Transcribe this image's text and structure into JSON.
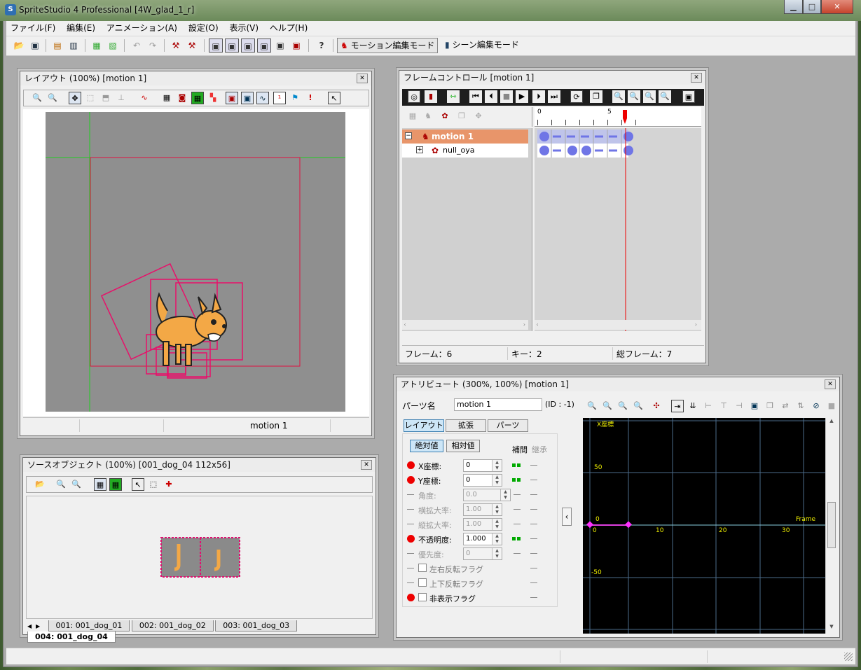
{
  "window": {
    "title": "SpriteStudio 4 Professional [4W_glad_1_r]",
    "app_icon": "spritestudio-icon"
  },
  "menu": [
    "ファイル(F)",
    "編集(E)",
    "アニメーション(A)",
    "設定(O)",
    "表示(V)",
    "ヘルプ(H)"
  ],
  "toolbar": {
    "motion_mode": "モーション編集モード",
    "scene_mode": "シーン編集モード"
  },
  "layout_panel": {
    "title": "レイアウト (100%) [motion 1]",
    "status": "motion 1"
  },
  "frame_panel": {
    "title": "フレームコントロール [motion 1]",
    "tree": [
      {
        "label": "motion 1",
        "selected": true
      },
      {
        "label": "null_oya",
        "selected": false
      }
    ],
    "ruler": {
      "zero": "0",
      "five": "5"
    },
    "status": {
      "frame": "フレーム：6",
      "key": "キー：2",
      "total": "総フレーム：7"
    }
  },
  "source_panel": {
    "title": "ソースオブジェクト (100%) [001_dog_04  112x56]",
    "tabs": [
      "001: 001_dog_01",
      "002: 001_dog_02",
      "003: 001_dog_03",
      "004: 001_dog_04"
    ],
    "active_tab": 3
  },
  "attr_panel": {
    "title": "アトリビュート (300%, 100%) [motion 1]",
    "part_name_label": "パーツ名",
    "part_name_value": "motion 1",
    "id_label": "(ID : -1)",
    "tabs": [
      "レイアウト",
      "拡張",
      "パーツ"
    ],
    "subtabs": [
      "絶対値",
      "相対値"
    ],
    "col_interp": "補間",
    "col_inherit": "継承",
    "rows": [
      {
        "label": "X座標:",
        "value": "0",
        "active": true
      },
      {
        "label": "Y座標:",
        "value": "0",
        "active": true
      },
      {
        "label": "角度:",
        "value": "0.0",
        "active": false
      },
      {
        "label": "横拡大率:",
        "value": "1.00",
        "active": false
      },
      {
        "label": "縦拡大率:",
        "value": "1.00",
        "active": false
      },
      {
        "label": "不透明度:",
        "value": "1.000",
        "active": true
      },
      {
        "label": "優先度:",
        "value": "0",
        "active": false
      }
    ],
    "flags": [
      {
        "label": "左右反転フラグ",
        "active": false
      },
      {
        "label": "上下反転フラグ",
        "active": false
      },
      {
        "label": "非表示フラグ",
        "active": true
      }
    ],
    "graph": {
      "y_title": "X座標",
      "y_ticks": [
        "50",
        "0",
        "-50"
      ],
      "x_ticks": [
        "0",
        "10",
        "20",
        "30"
      ],
      "x_title": "Frame"
    }
  },
  "colors": {
    "accent_red": "#ee0000",
    "graph_bg": "#000000",
    "key_blue": "#6f75e6",
    "selection": "#e8956a"
  }
}
